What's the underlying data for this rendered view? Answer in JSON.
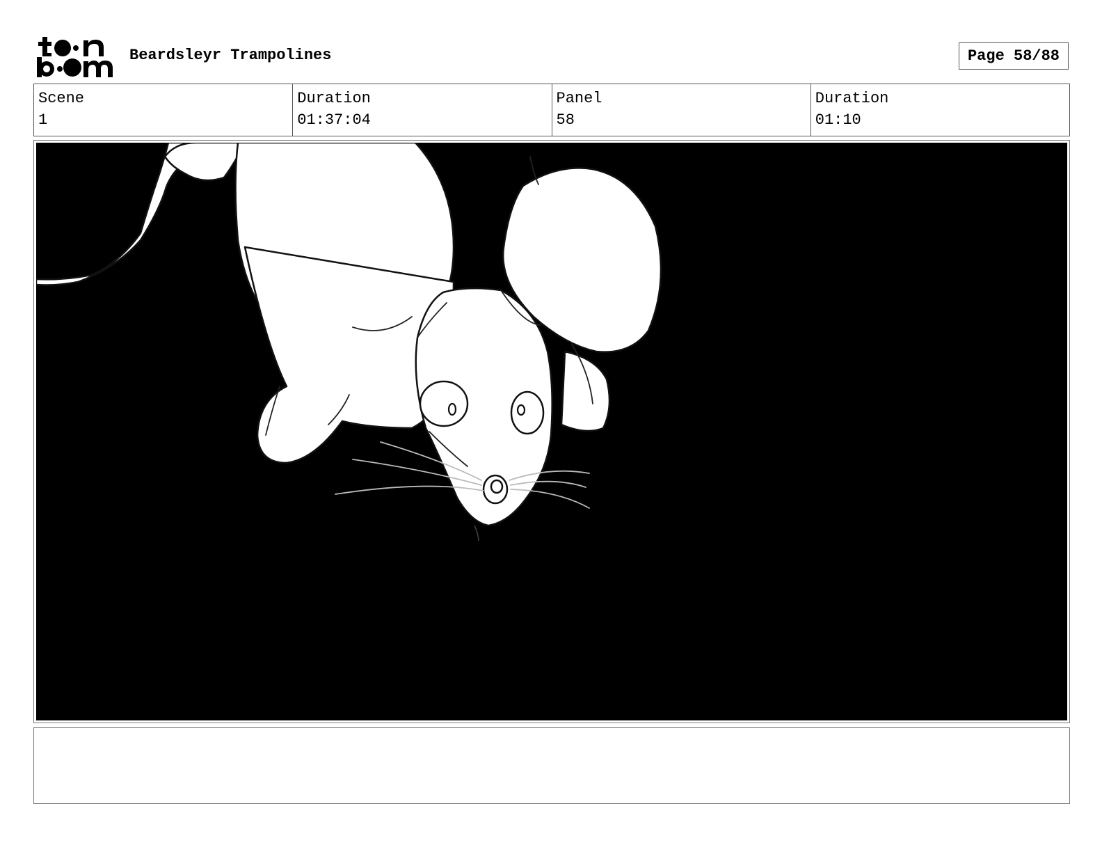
{
  "header": {
    "logo_text_top": "toon",
    "logo_text_bottom": "boom",
    "project_title": "Beardsleyr Trampolines",
    "page_label": "Page 58/88"
  },
  "info": {
    "scene_label": "Scene",
    "scene_value": "1",
    "scene_duration_label": "Duration",
    "scene_duration_value": "01:37:04",
    "panel_label": "Panel",
    "panel_value": "58",
    "panel_duration_label": "Duration",
    "panel_duration_value": "01:10"
  },
  "panel": {
    "background_color": "#000000",
    "drawing_color": "#ffffff"
  },
  "notes": {
    "text": ""
  }
}
